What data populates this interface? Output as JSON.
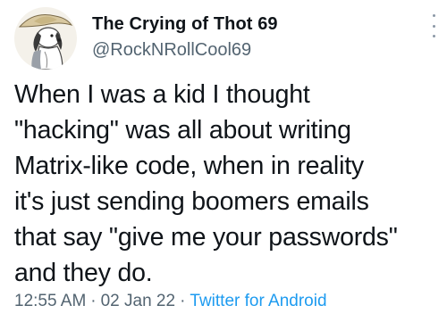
{
  "author": {
    "display_name": "The Crying of Thot 69",
    "handle": "@RockNRollCool69",
    "avatar_icon": "cartoon-dog-avatar"
  },
  "tweet": {
    "lines": [
      "When I was a kid I thought",
      "\"hacking\" was all about writing",
      "Matrix-like code, when in reality",
      "it's just sending boomers emails",
      "that say \"give me your passwords\"",
      "and they do."
    ]
  },
  "meta": {
    "time": "12:55 AM",
    "separator": "·",
    "date": "02 Jan 22",
    "source": "Twitter for Android"
  },
  "icons": {
    "more": "more-options-icon"
  },
  "colors": {
    "text": "#0f1419",
    "secondary": "#536471",
    "link": "#1d9bf0"
  }
}
